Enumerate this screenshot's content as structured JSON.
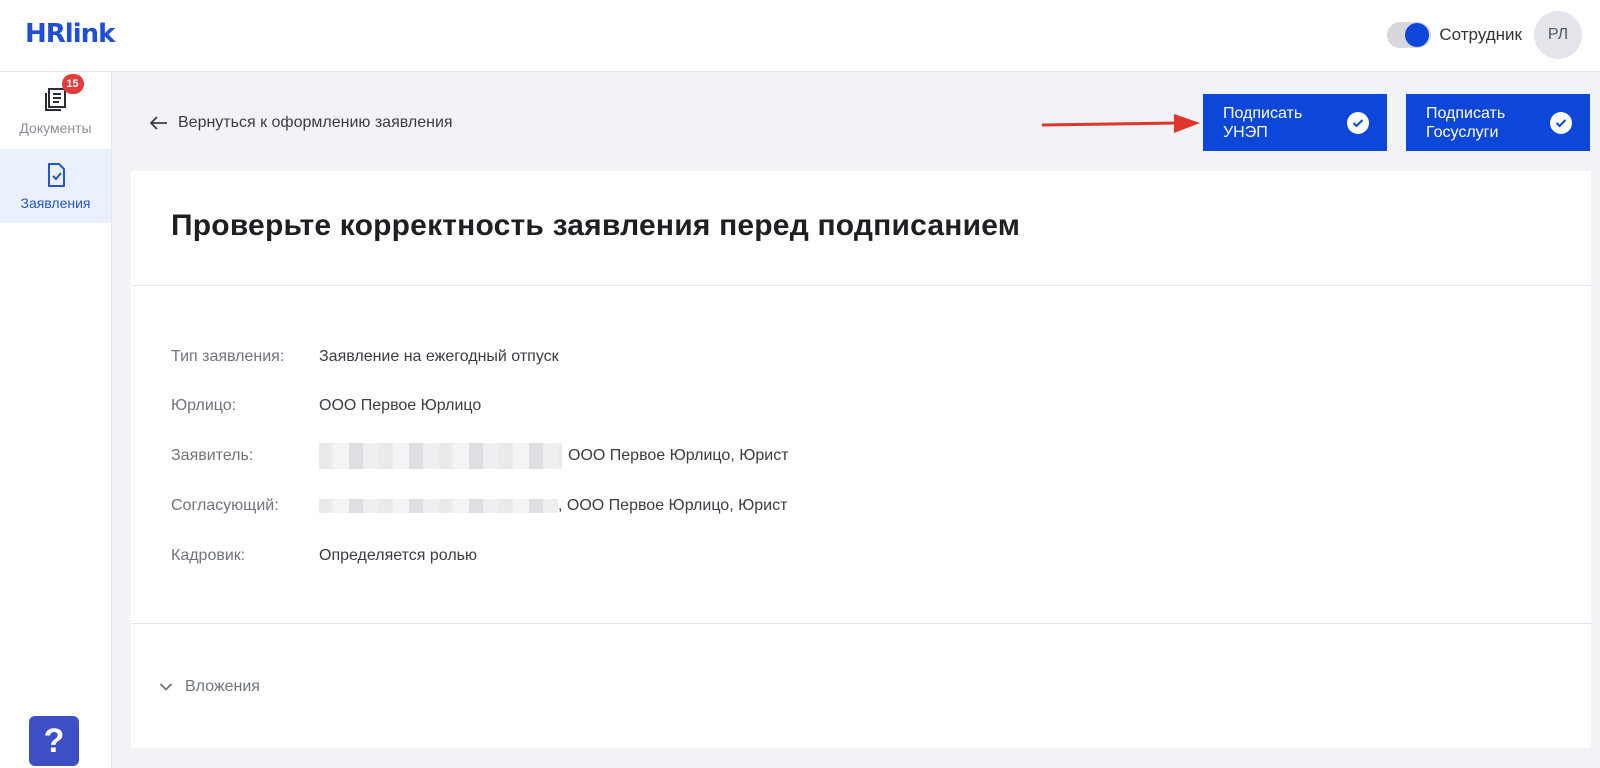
{
  "app": {
    "logo_text": "HRlink",
    "brand_color": "#0d47d9"
  },
  "header": {
    "role_label": "Сотрудник",
    "avatar_initials": "РЛ",
    "toggle_on": true
  },
  "sidebar": {
    "items": [
      {
        "label": "Документы",
        "icon": "documents-icon",
        "badge": "15",
        "active": false
      },
      {
        "label": "Заявления",
        "icon": "application-file-icon",
        "active": true
      }
    ],
    "help_label": "?"
  },
  "toolbar": {
    "back_label": "Вернуться к оформлению заявления",
    "sign_unep_label": "Подписать\nУНЭП",
    "sign_gos_label": "Подписать\nГосуслуги"
  },
  "card": {
    "title": "Проверьте корректность заявления перед подписанием",
    "fields": [
      {
        "label": "Тип заявления:",
        "value": "Заявление на ежегодный отпуск"
      },
      {
        "label": "Юрлицо:",
        "value": "ООО Первое Юрлицо"
      },
      {
        "label": "Заявитель:",
        "value": "ООО Первое Юрлицо, Юрист"
      },
      {
        "label": "Согласующий:",
        "value": ", ООО Первое Юрлицо, Юрист"
      },
      {
        "label": "Кадровик:",
        "value": "Определяется ролью"
      }
    ],
    "attachments_label": "Вложения"
  }
}
